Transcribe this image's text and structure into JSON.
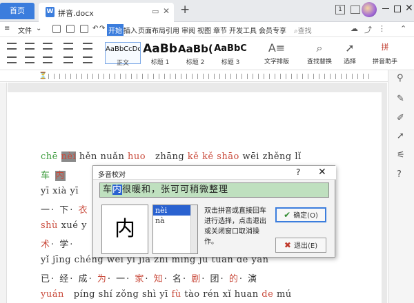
{
  "titlebar": {
    "home_tab": "首页",
    "doc_icon": "W",
    "doc_name": "拼音.docx",
    "new_tab": "+",
    "badge_number": "1"
  },
  "menubar": {
    "items": [
      "文件",
      "开始",
      "插入",
      "页面布局",
      "引用",
      "审阅",
      "视图",
      "章节",
      "开发工具",
      "会员专享"
    ],
    "search": "查找"
  },
  "ribbon": {
    "styles": [
      {
        "sample": "AaBbCcDd",
        "label": "正文"
      },
      {
        "sample": "AaBb",
        "label": "标题 1"
      },
      {
        "sample": "AaBb(",
        "label": "标题 2"
      },
      {
        "sample": "AaBbC",
        "label": "标题 3"
      }
    ],
    "tools": [
      "文字排版",
      "查找替换",
      "选择",
      "拼音助手"
    ]
  },
  "document": {
    "line1": [
      "chē",
      "nèi",
      "hěn",
      "nuǎn",
      "huo",
      "zhāng",
      "kě",
      "kě",
      "shāo",
      "wēi",
      "zhěng",
      "lǐ"
    ],
    "line2": [
      "车",
      "内"
    ],
    "line3": [
      "yī",
      "xià",
      "yī"
    ],
    "line4": [
      "一",
      "下",
      "衣"
    ],
    "line5": [
      "shù",
      "xué",
      "y"
    ],
    "line6": [
      "术",
      "学"
    ],
    "line7": "yǐ jīng chéng wéi yī jiā zhī míng jù tuán de yǎn",
    "line8": [
      "已",
      "经",
      "成",
      "为",
      "一",
      "家",
      "知",
      "名",
      "剧",
      "团",
      "的",
      "演"
    ],
    "line9": [
      "yuán",
      "píng",
      "shí",
      "zǒng",
      "shì",
      "yī",
      "fù",
      "tào",
      "rén",
      "xǐ",
      "huan",
      "de",
      "mú"
    ]
  },
  "dialog": {
    "title": "多音校对",
    "help": "?",
    "close": "✕",
    "sentence_prefix": "车",
    "sentence_selected": "内",
    "sentence_suffix": "很暖和，张可可稍微整理",
    "current_char": "内",
    "options": [
      "nèi",
      "nà"
    ],
    "instructions": "双击拼音或直接回车进行选择，点击退出或关闭窗口取消操作。",
    "ok_label": "确定(O)",
    "cancel_label": "退出(E)"
  }
}
